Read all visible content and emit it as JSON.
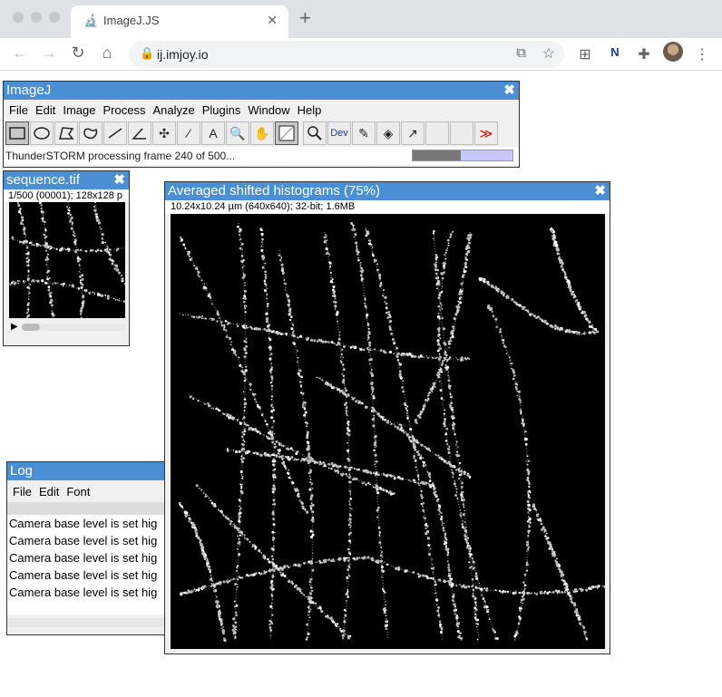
{
  "browser": {
    "tab_title": "ImageJ.JS",
    "url": "ij.imjoy.io"
  },
  "imagej": {
    "title": "ImageJ",
    "menu": [
      "File",
      "Edit",
      "Image",
      "Process",
      "Analyze",
      "Plugins",
      "Window",
      "Help"
    ],
    "tool_dev_label": "Dev",
    "more_tools": "≫",
    "status": "ThunderSTORM processing frame 240 of 500...",
    "progress_fraction": 0.48
  },
  "sequence": {
    "title": "sequence.tif",
    "info": "1/500 (00001); 128x128 p"
  },
  "averaged": {
    "title": "Averaged shifted histograms (75%)",
    "info": "10.24x10.24 µm (640x640); 32-bit; 1.6MB"
  },
  "log": {
    "title": "Log",
    "menu": [
      "File",
      "Edit",
      "Font"
    ],
    "lines": [
      "Camera base level is set hig",
      "Camera base level is set hig",
      "Camera base level is set hig",
      "Camera base level is set hig",
      "Camera base level is set hig"
    ]
  },
  "colors": {
    "title_bar": "#4a8fd3",
    "progress_bg": "#c8c8f8"
  }
}
